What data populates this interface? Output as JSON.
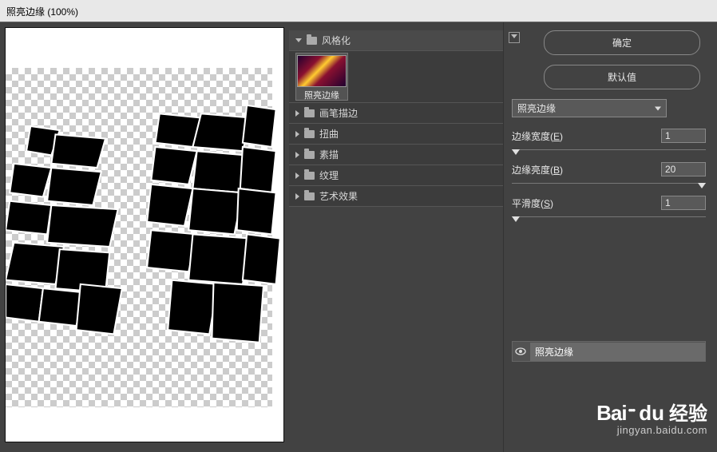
{
  "title": "照亮边缘 (100%)",
  "categories": {
    "expanded": "风格化",
    "expanded_thumb": "照亮边缘",
    "items": [
      "画笔描边",
      "扭曲",
      "素描",
      "纹理",
      "艺术效果"
    ]
  },
  "buttons": {
    "ok": "确定",
    "default": "默认值"
  },
  "filter_select": "照亮边缘",
  "sliders": {
    "edge_width": {
      "label_pre": "边缘宽度(",
      "hotkey": "E",
      "label_post": ")",
      "value": "1",
      "pos": "0%"
    },
    "edge_brightness": {
      "label_pre": "边缘亮度(",
      "hotkey": "B",
      "label_post": ")",
      "value": "20",
      "pos": "100%"
    },
    "smoothness": {
      "label_pre": "平滑度(",
      "hotkey": "S",
      "label_post": ")",
      "value": "1",
      "pos": "0%"
    }
  },
  "layer": {
    "name": "照亮边缘"
  },
  "watermark": {
    "brand_a": "Bai",
    "brand_b": "du",
    "brand_c": "经验",
    "sub": "jingyan.baidu.com"
  }
}
